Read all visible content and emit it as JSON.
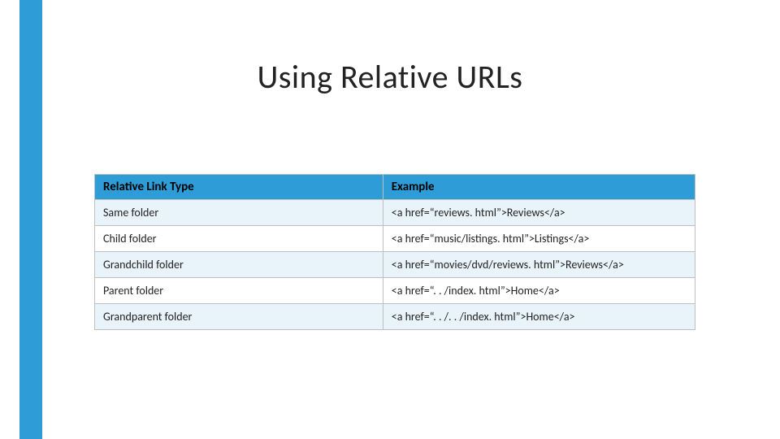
{
  "slide": {
    "title": "Using Relative URLs"
  },
  "table": {
    "headers": {
      "col1": "Relative Link Type",
      "col2": "Example"
    },
    "rows": [
      {
        "type": "Same folder",
        "example": "<a href=“reviews. html”>Reviews</a>"
      },
      {
        "type": "Child folder",
        "example": "<a href=“music/listings. html”>Listings</a>"
      },
      {
        "type": "Grandchild folder",
        "example": "<a href=“movies/dvd/reviews. html”>Reviews</a>"
      },
      {
        "type": "Parent folder",
        "example": "<a href=“. . /index. html”>Home</a>"
      },
      {
        "type": "Grandparent folder",
        "example": "<a href=“. . /. . /index. html”>Home</a>"
      }
    ]
  },
  "chart_data": {
    "type": "table",
    "title": "Using Relative URLs",
    "columns": [
      "Relative Link Type",
      "Example"
    ],
    "rows": [
      [
        "Same folder",
        "<a href=“reviews. html”>Reviews</a>"
      ],
      [
        "Child folder",
        "<a href=“music/listings. html”>Listings</a>"
      ],
      [
        "Grandchild folder",
        "<a href=“movies/dvd/reviews. html”>Reviews</a>"
      ],
      [
        "Parent folder",
        "<a href=“. . /index. html”>Home</a>"
      ],
      [
        "Grandparent folder",
        "<a href=“. . /. . /index. html”>Home</a>"
      ]
    ]
  },
  "colors": {
    "accent": "#2e9cd6"
  }
}
